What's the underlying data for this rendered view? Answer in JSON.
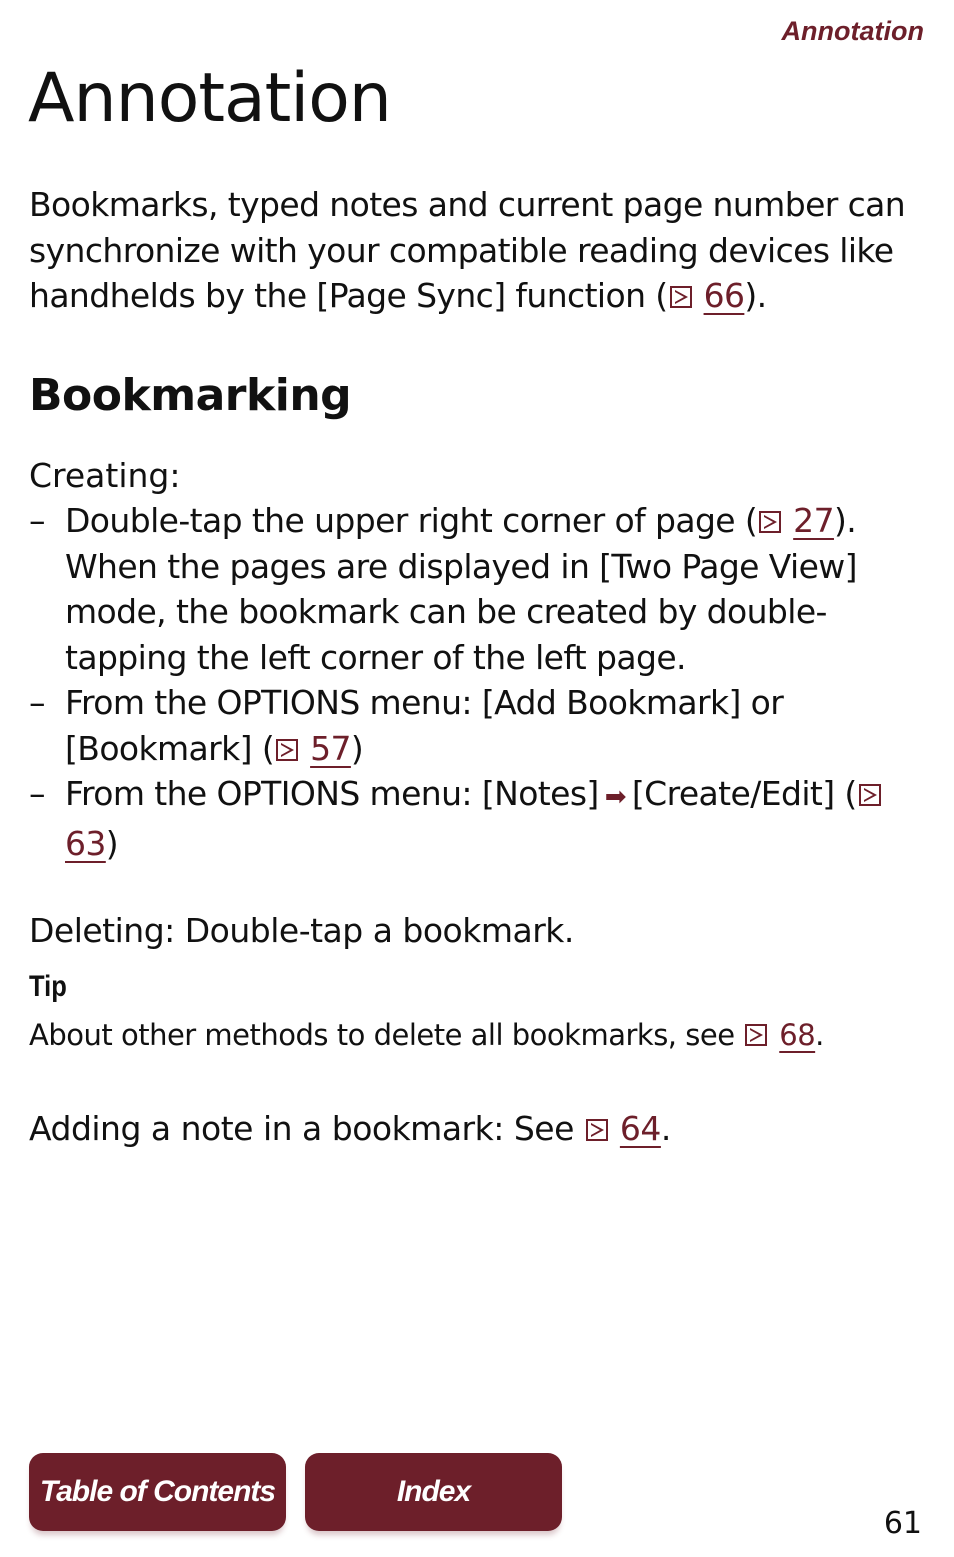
{
  "header": {
    "running_head": "Annotation"
  },
  "page_title": "Annotation",
  "intro": {
    "text": "Bookmarks, typed notes and current page number can synchronize with your compatible reading devices like handhelds by the [Page Sync] function (",
    "ref": "66",
    "after": ")."
  },
  "section": {
    "heading": "Bookmarking",
    "creating_label": "Creating:",
    "items": [
      {
        "text": "Double-tap the upper right corner of page (",
        "ref": "27",
        "after": "). When the pages are displayed in [Two Page View] mode, the bookmark can be created by double-tapping the left corner of the left page."
      },
      {
        "text": "From the OPTIONS menu: [Add Bookmark] or [Bookmark] (",
        "ref": "57",
        "after": ")"
      },
      {
        "text": "From the OPTIONS menu: [Notes]",
        "text2": "[Create/Edit] (",
        "ref": "63",
        "after": ")"
      }
    ],
    "dash": "–",
    "deleting": "Deleting: Double-tap a bookmark.",
    "tip_label": "Tip",
    "tip_text": "About other methods to delete all bookmarks, see",
    "tip_ref": "68",
    "tip_after": ".",
    "adding_text": "Adding a note in a bookmark: See",
    "adding_ref": "64",
    "adding_after": "."
  },
  "footer": {
    "toc_label": "Table of Contents",
    "index_label": "Index",
    "page_number": "61"
  },
  "colors": {
    "accent": "#6d1f2a"
  }
}
